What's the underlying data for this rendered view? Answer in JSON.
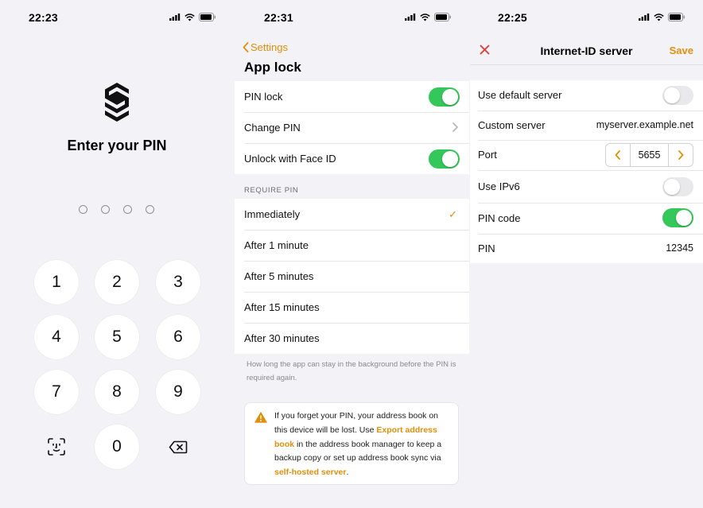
{
  "colors": {
    "accent": "#e0900b",
    "toggle_on": "#34c759",
    "background": "#f2f2f7"
  },
  "screen1": {
    "time": "22:23",
    "title": "Enter your PIN",
    "keys": [
      "1",
      "2",
      "3",
      "4",
      "5",
      "6",
      "7",
      "8",
      "9",
      "0"
    ],
    "left_key_icon": "face-id-icon",
    "right_key_icon": "backspace-icon"
  },
  "screen2": {
    "time": "22:31",
    "back_label": "Settings",
    "title": "App lock",
    "rows": {
      "pin_lock": "PIN lock",
      "change_pin": "Change PIN",
      "face_id": "Unlock with Face ID"
    },
    "section_header": "REQUIRE PIN",
    "options": [
      "Immediately",
      "After 1 minute",
      "After 5 minutes",
      "After 15 minutes",
      "After 30 minutes"
    ],
    "selected_option": "Immediately",
    "footnote": "How long the app can stay in the background before the PIN is required again.",
    "warning": {
      "part1": "If you forget your PIN, your address book on this device will be lost. Use ",
      "link1": "Export address book",
      "part2": " in the address book manager to keep a backup copy or set up address book sync via ",
      "link2": "self-hosted server",
      "part3": "."
    }
  },
  "screen3": {
    "time": "22:25",
    "title": "Internet-ID server",
    "save_label": "Save",
    "default_server_label": "Use default server",
    "custom_server_label": "Custom server",
    "custom_server_value": "myserver.example.net",
    "port_label": "Port",
    "port_value": "5655",
    "ipv6_label": "Use IPv6",
    "pin_code_label": "PIN code",
    "pin_label": "PIN",
    "pin_value": "12345"
  }
}
